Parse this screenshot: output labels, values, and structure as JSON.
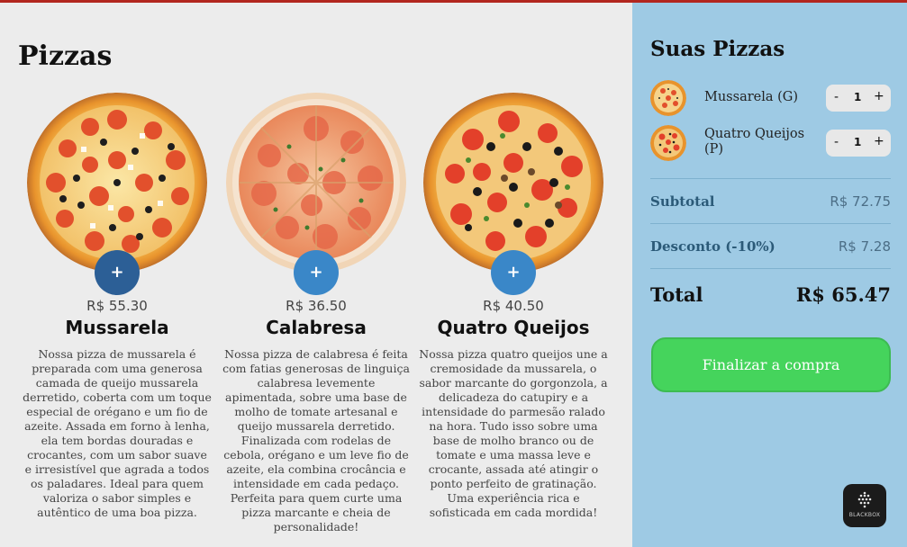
{
  "main": {
    "title": "Pizzas",
    "products": [
      {
        "price": "R$ 55.30",
        "name": "Mussarela",
        "add_label": "+",
        "image": "pizza-mussarela-icon",
        "description": "Nossa pizza de mussarela é preparada com uma generosa camada de queijo mussarela derretido, coberta com um toque especial de orégano e um fio de azeite. Assada em forno à lenha, ela tem bordas douradas e crocantes, com um sabor suave e irresistível que agrada a todos os paladares. Ideal para quem valoriza o sabor simples e autêntico de uma boa pizza."
      },
      {
        "price": "R$ 36.50",
        "name": "Calabresa",
        "add_label": "+",
        "image": "pizza-calabresa-icon",
        "description": "Nossa pizza de calabresa é feita com fatias generosas de linguiça calabresa levemente apimentada, sobre uma base de molho de tomate artesanal e queijo mussarela derretido. Finalizada com rodelas de cebola, orégano e um leve fio de azeite, ela combina crocância e intensidade em cada pedaço. Perfeita para quem curte uma pizza marcante e cheia de personalidade!"
      },
      {
        "price": "R$ 40.50",
        "name": "Quatro Queijos",
        "add_label": "+",
        "image": "pizza-quatro-queijos-icon",
        "description": "Nossa pizza quatro queijos une a cremosidade da mussarela, o sabor marcante do gorgonzola, a delicadeza do catupiry e a intensidade do parmesão ralado na hora. Tudo isso sobre uma base de molho branco ou de tomate e uma massa leve e crocante, assada até atingir o ponto perfeito de gratinação. Uma experiência rica e sofisticada em cada mordida!"
      }
    ]
  },
  "cart": {
    "title": "Suas Pizzas",
    "items": [
      {
        "name": "Mussarela (G)",
        "quantity": "1",
        "minus": "-",
        "plus": "+",
        "thumb": "pizza-thumb-icon"
      },
      {
        "name": "Quatro Queijos (P)",
        "quantity": "1",
        "minus": "-",
        "plus": "+",
        "thumb": "pizza-thumb-icon"
      }
    ],
    "subtotal_label": "Subtotal",
    "subtotal_value": "R$ 72.75",
    "discount_label": "Desconto (-10%)",
    "discount_value": "R$ 7.28",
    "total_label": "Total",
    "total_value": "R$ 65.47",
    "checkout_label": "Finalizar a compra"
  },
  "badge": {
    "label": "BLACKBOX",
    "icon": "blackbox-logo-icon"
  },
  "colors": {
    "sidebar_bg": "#9ecae4",
    "main_bg": "#ececec",
    "add_button_dark": "#2c5f96",
    "add_button": "#3a87c8",
    "checkout": "#45d45c",
    "top_bar": "#b2261e"
  }
}
